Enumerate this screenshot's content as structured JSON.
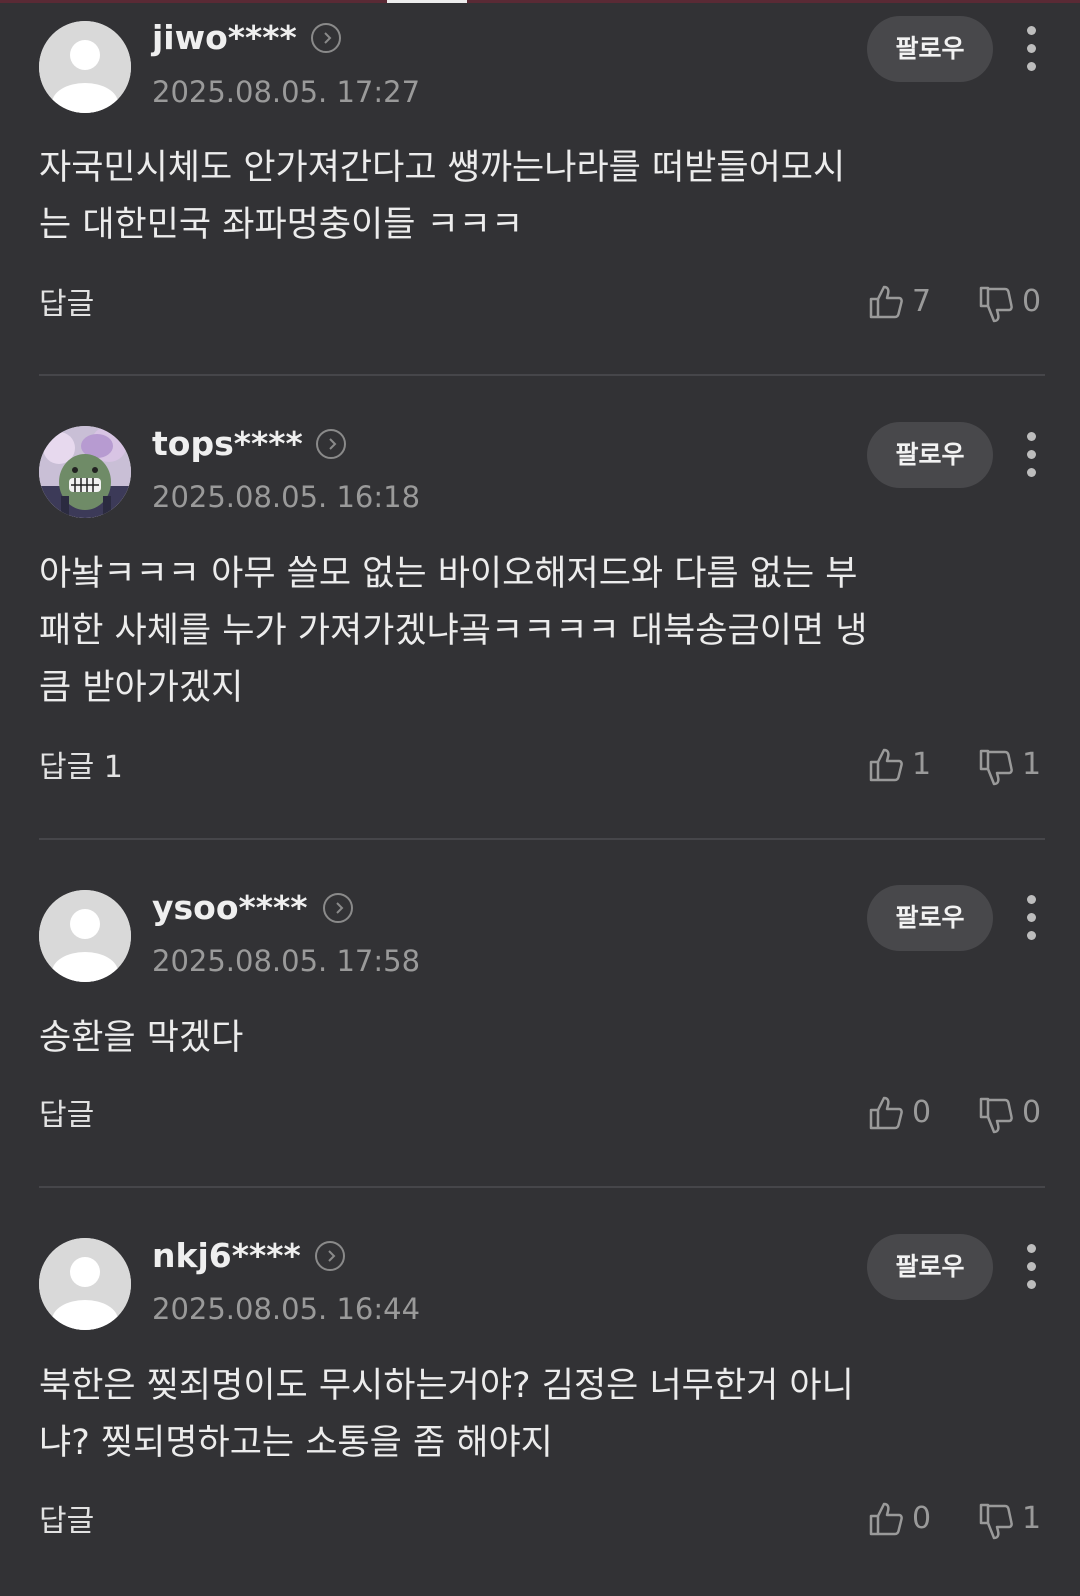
{
  "comments": [
    {
      "username": "jiwo****",
      "timestamp": "2025.08.05. 17:27",
      "text": "자국민시체도 안가져간다고 썡까는나라를 떠받들어모시\n는 대한민국 좌파멍충이들 ㅋㅋㅋ",
      "reply_label": "답글",
      "follow_label": "팔로우",
      "likes": "7",
      "dislikes": "0",
      "avatar": "default-avatar-icon"
    },
    {
      "username": "tops****",
      "timestamp": "2025.08.05. 16:18",
      "text": "아놬ㅋㅋㅋ 아무 쓸모 없는 바이오해저드와 다름 없는 부\n패한 사체를 누가 가져가겠냐곸ㅋㅋㅋㅋ 대북송금이면 냉\n큼 받아가겠지",
      "reply_label": "답글 1",
      "follow_label": "팔로우",
      "likes": "1",
      "dislikes": "1",
      "avatar": "custom-avatar-image"
    },
    {
      "username": "ysoo****",
      "timestamp": "2025.08.05. 17:58",
      "text": "송환을 막겠다",
      "reply_label": "답글",
      "follow_label": "팔로우",
      "likes": "0",
      "dislikes": "0",
      "avatar": "default-avatar-icon"
    },
    {
      "username": "nkj6****",
      "timestamp": "2025.08.05. 16:44",
      "text": "북한은 찢죄명이도 무시하는거야? 김정은 너무한거 아니\n냐? 찢되명하고는 소통을 좀 해야지",
      "reply_label": "답글",
      "follow_label": "팔로우",
      "likes": "0",
      "dislikes": "1",
      "avatar": "default-avatar-icon"
    }
  ],
  "icons": {
    "like": "thumbs-up-icon",
    "dislike": "thumbs-down-icon",
    "more": "more-vertical-icon",
    "profile": "chevron-right-circle-icon"
  },
  "colors": {
    "background": "#323235",
    "follow_button": "#48484b",
    "muted_text": "#9a9a9a"
  }
}
